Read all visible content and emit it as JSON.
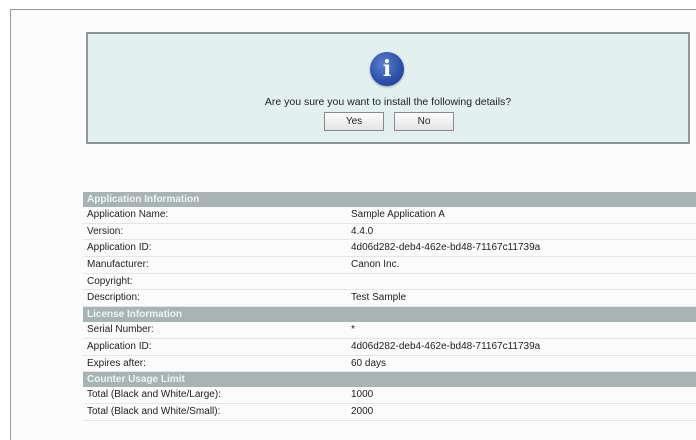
{
  "dialog": {
    "message": "Are you sure you want to install the following details?",
    "yes_label": "Yes",
    "no_label": "No",
    "icon": "info-icon"
  },
  "application_information": {
    "header": "Application Information",
    "rows": [
      {
        "label": "Application Name:",
        "value": "Sample Application A"
      },
      {
        "label": "Version:",
        "value": "4.4.0"
      },
      {
        "label": "Application ID:",
        "value": "4d06d282-deb4-462e-bd48-71167c11739a"
      },
      {
        "label": "Manufacturer:",
        "value": "Canon Inc."
      },
      {
        "label": "Copyright:",
        "value": ""
      },
      {
        "label": "Description:",
        "value": "Test Sample"
      }
    ]
  },
  "license_information": {
    "header": "License Information",
    "rows": [
      {
        "label": "Serial Number:",
        "value": "*"
      },
      {
        "label": "Application ID:",
        "value": "4d06d282-deb4-462e-bd48-71167c11739a"
      },
      {
        "label": "Expires after:",
        "value": "60 days"
      }
    ]
  },
  "counter_usage_limit": {
    "header": "Counter Usage Limit",
    "rows": [
      {
        "label": "Total (Black and White/Large):",
        "value": "1000"
      },
      {
        "label": "Total (Black and White/Small):",
        "value": "2000"
      }
    ]
  },
  "colors": {
    "dialog_bg": "#e3f0f0",
    "section_header_bg": "#a8b4b4",
    "icon_blue": "#2b4fa6"
  }
}
